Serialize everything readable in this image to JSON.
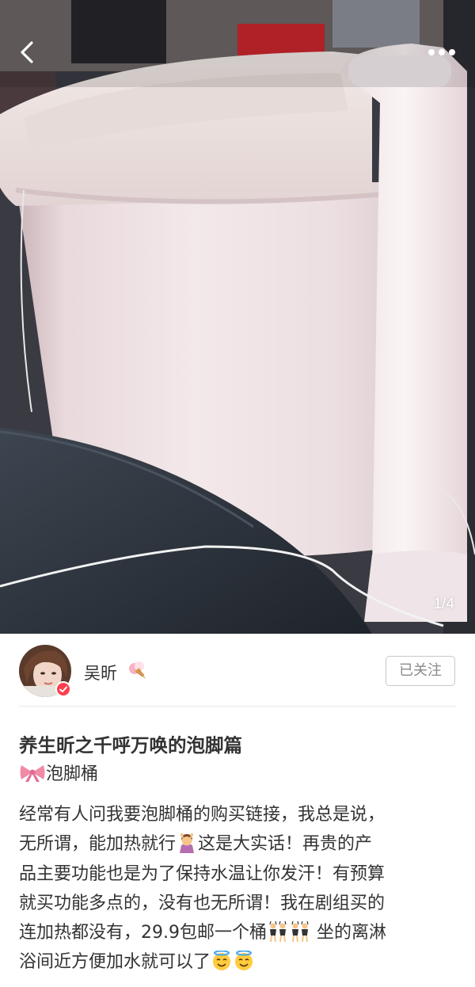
{
  "header": {
    "back_icon": "chevron-left-icon",
    "more_icon": "ellipsis-icon",
    "page_indicator": "1/4"
  },
  "author": {
    "name": "吴昕",
    "name_emoji": "ice-cream-icon",
    "verified_badge": "verified-badge-icon",
    "follow_label": "已关注"
  },
  "post": {
    "title": "养生昕之千呼万唤的泡脚篇",
    "tag_icon": "ribbon-bow-icon",
    "tag": "泡脚桶",
    "line1": "经常有人问我要泡脚桶的购买链接，我总是说，",
    "line2_a": "无所谓，能加热就行",
    "line2_b": "这是大实话！再贵的产",
    "line3": "品主要功能也是为了保持水温让你发汗！有预算",
    "line4": "就买功能多点的，没有也无所谓！我在剧组买的",
    "line5_a": "连加热都没有，29.9包邮一个桶",
    "line5_b": "坐的离淋",
    "line6_a": "浴间近方便加水就可以了",
    "emojis": [
      "woman-raising-hand-icon",
      "dancers-icon",
      "smiling-face-with-halo-icon"
    ]
  },
  "colors": {
    "text": "#333333",
    "muted": "#8a8a8a",
    "border": "#c8c8c8",
    "divider": "#e8e8e8",
    "verified": "#ff3e4d"
  }
}
